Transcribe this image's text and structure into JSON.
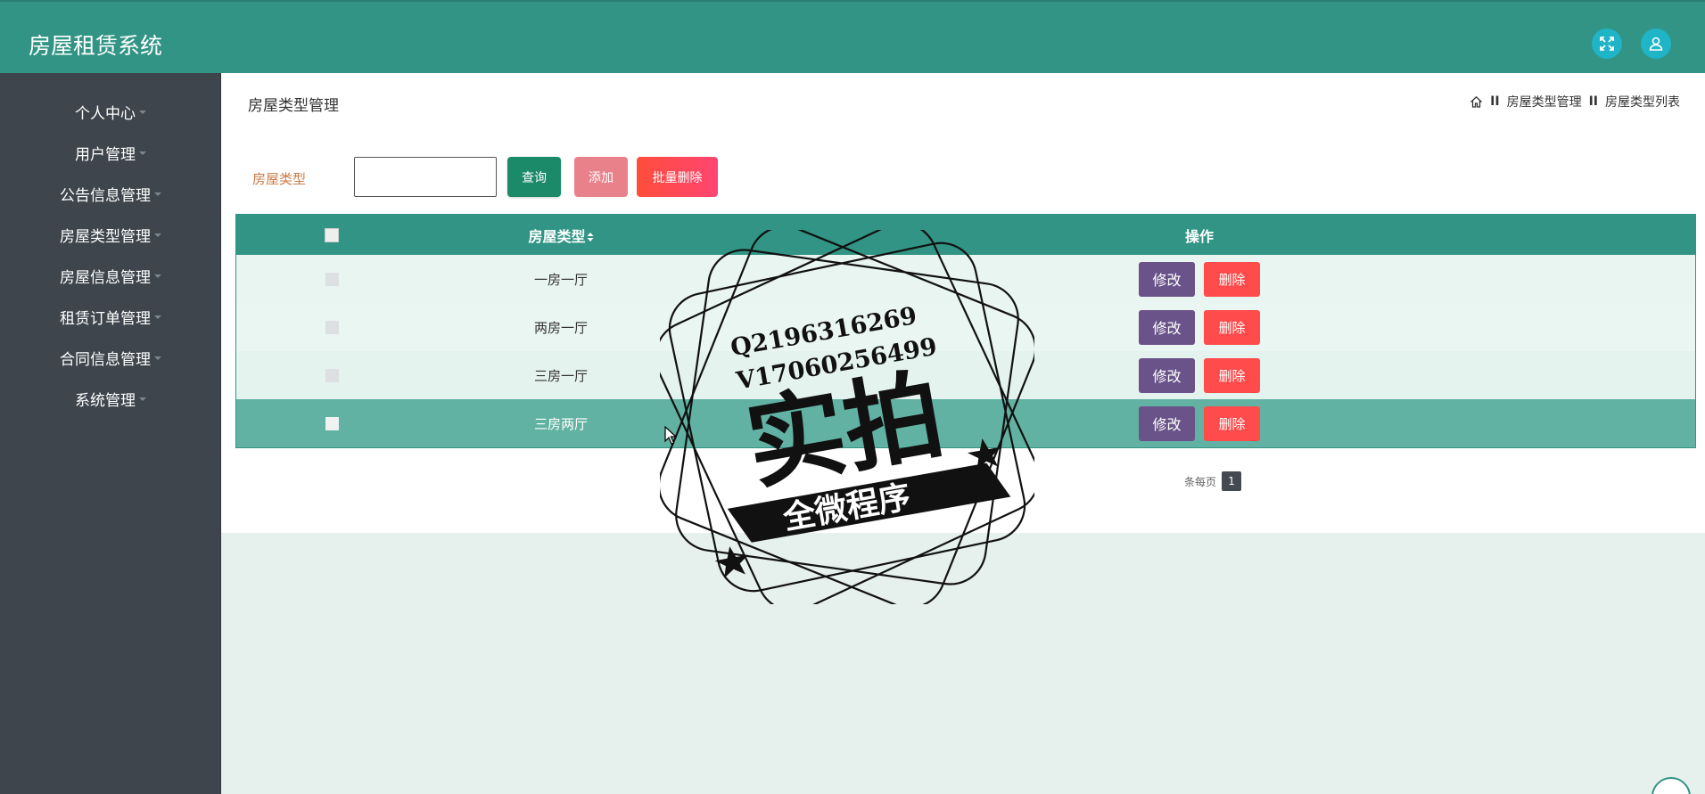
{
  "app": {
    "title": "房屋租赁系统"
  },
  "header": {
    "icons": [
      "fullscreen-icon",
      "user-icon"
    ]
  },
  "sidebar": {
    "items": [
      {
        "label": "个人中心"
      },
      {
        "label": "用户管理"
      },
      {
        "label": "公告信息管理"
      },
      {
        "label": "房屋类型管理"
      },
      {
        "label": "房屋信息管理"
      },
      {
        "label": "租赁订单管理"
      },
      {
        "label": "合同信息管理"
      },
      {
        "label": "系统管理"
      }
    ]
  },
  "page": {
    "title": "房屋类型管理",
    "breadcrumb": {
      "sep": "II",
      "level1": "房屋类型管理",
      "level2": "房屋类型列表"
    }
  },
  "search": {
    "label": "房屋类型",
    "value": "",
    "query_button": "查询",
    "add_button": "添加",
    "batch_delete_button": "批量删除"
  },
  "table": {
    "columns": {
      "type": "房屋类型",
      "ops": "操作"
    },
    "rows": [
      {
        "type": "一房一厅"
      },
      {
        "type": "两房一厅"
      },
      {
        "type": "三房一厅"
      },
      {
        "type": "三房两厅"
      }
    ],
    "edit_label": "修改",
    "delete_label": "删除",
    "row_colors": [
      "#e8f5f1",
      "#eaf6f1",
      "#e5f3ef",
      "#62b2a3"
    ]
  },
  "pagination": {
    "text": "条每页",
    "page": "1"
  },
  "watermark": {
    "line1": "Q2196316269",
    "line2": "V17060256499",
    "main": "实拍",
    "banner": "全微程序"
  },
  "colors": {
    "topbar": "#319485",
    "sidebar": "#3f454c",
    "accent": "#319485"
  }
}
